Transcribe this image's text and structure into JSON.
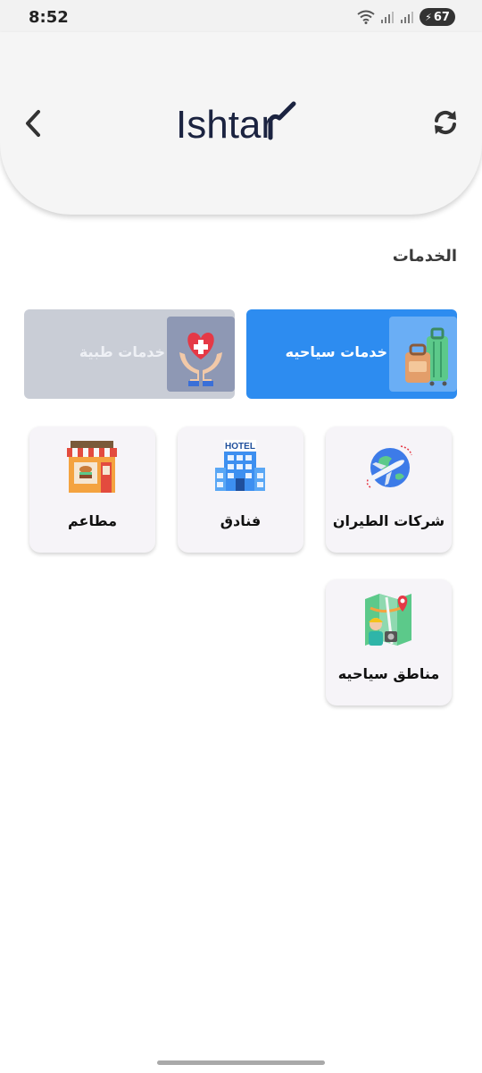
{
  "status_bar": {
    "time": "8:52",
    "battery": "67"
  },
  "header": {
    "logo_text": "Ishtar",
    "back_icon": "chevron-left-icon",
    "refresh_icon": "refresh-icon"
  },
  "section": {
    "title": "الخدمات"
  },
  "categories": [
    {
      "label": "خدمات سياحيه",
      "icon": "luggage-icon",
      "color": "#2d8cf0",
      "selected": true
    },
    {
      "label": "خدمات طبية",
      "icon": "medical-care-icon",
      "color": "#c9cdd6",
      "selected": false
    }
  ],
  "services": [
    {
      "label": "شركات الطيران",
      "icon": "airplane-globe-icon"
    },
    {
      "label": "فنادق",
      "icon": "hotel-icon",
      "icon_text": "HOTEL"
    },
    {
      "label": "مطاعم",
      "icon": "restaurant-icon"
    },
    {
      "label": "مناطق سياحيه",
      "icon": "tourist-map-icon"
    }
  ]
}
